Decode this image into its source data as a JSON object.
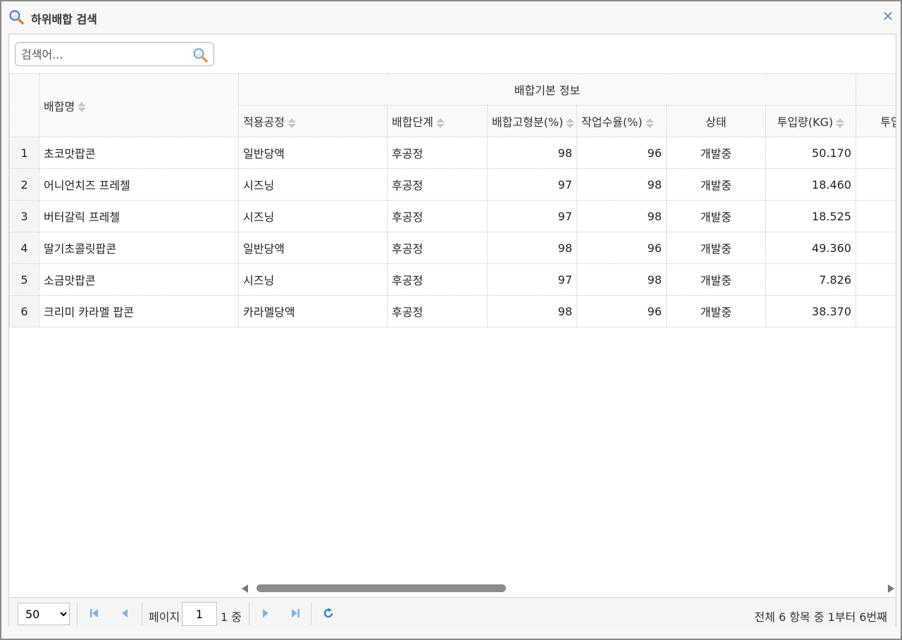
{
  "window": {
    "title": "하위배합 검색"
  },
  "search": {
    "placeholder": "검색어..."
  },
  "table": {
    "group_header": "배합기본 정보",
    "columns": {
      "name": "배합명",
      "process": "적용공정",
      "stage": "배합단계",
      "solids": "배합고형분(%)",
      "yield": "작업수율(%)",
      "status": "상태",
      "input": "투입량(KG)",
      "input2": "투입"
    },
    "rows": [
      {
        "no": "1",
        "name": "초코맛팝콘",
        "process": "일반당액",
        "stage": "후공정",
        "solids": "98",
        "yield": "96",
        "status": "개발중",
        "input": "50.170"
      },
      {
        "no": "2",
        "name": "어니언치즈 프레첼",
        "process": "시즈닝",
        "stage": "후공정",
        "solids": "97",
        "yield": "98",
        "status": "개발중",
        "input": "18.460"
      },
      {
        "no": "3",
        "name": "버터갈릭 프레첼",
        "process": "시즈닝",
        "stage": "후공정",
        "solids": "97",
        "yield": "98",
        "status": "개발중",
        "input": "18.525"
      },
      {
        "no": "4",
        "name": "딸기초콜릿팝콘",
        "process": "일반당액",
        "stage": "후공정",
        "solids": "98",
        "yield": "96",
        "status": "개발중",
        "input": "49.360"
      },
      {
        "no": "5",
        "name": "소금맛팝콘",
        "process": "시즈닝",
        "stage": "후공정",
        "solids": "97",
        "yield": "98",
        "status": "개발중",
        "input": "7.826"
      },
      {
        "no": "6",
        "name": "크리미 카라멜 팝콘",
        "process": "카라멜당액",
        "stage": "후공정",
        "solids": "98",
        "yield": "96",
        "status": "개발중",
        "input": "38.370"
      }
    ]
  },
  "pager": {
    "page_size": "50",
    "page_size_options": [
      "50"
    ],
    "page_label": "페이지",
    "page_value": "1",
    "of_label": "1 중",
    "info": "전체 6 항목 중 1부터 6번째"
  },
  "colors": {
    "accent": "#4a90d9",
    "scroll_thumb": "#8c8c8c"
  }
}
